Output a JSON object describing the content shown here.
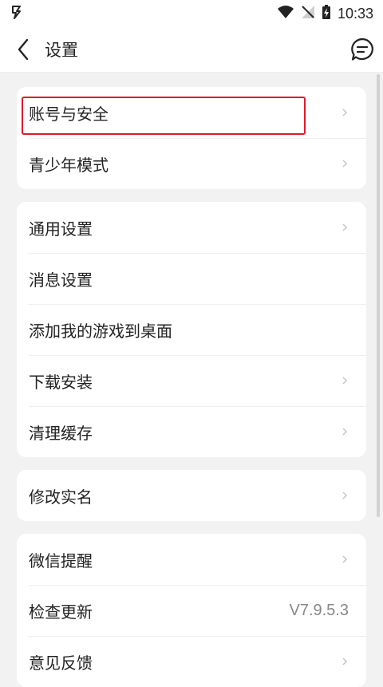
{
  "status_bar": {
    "time": "10:33"
  },
  "header": {
    "title": "设置"
  },
  "groups": [
    {
      "items": [
        {
          "label": "账号与安全"
        },
        {
          "label": "青少年模式"
        }
      ]
    },
    {
      "items": [
        {
          "label": "通用设置"
        },
        {
          "label": "消息设置"
        },
        {
          "label": "添加我的游戏到桌面"
        },
        {
          "label": "下载安装"
        },
        {
          "label": "清理缓存"
        }
      ]
    },
    {
      "items": [
        {
          "label": "修改实名"
        }
      ]
    },
    {
      "items": [
        {
          "label": "微信提醒"
        },
        {
          "label": "检查更新",
          "value": "V7.9.5.3"
        },
        {
          "label": "意见反馈"
        }
      ]
    }
  ],
  "colors": {
    "highlight": "#e0182c",
    "background": "#f2f2f2"
  }
}
